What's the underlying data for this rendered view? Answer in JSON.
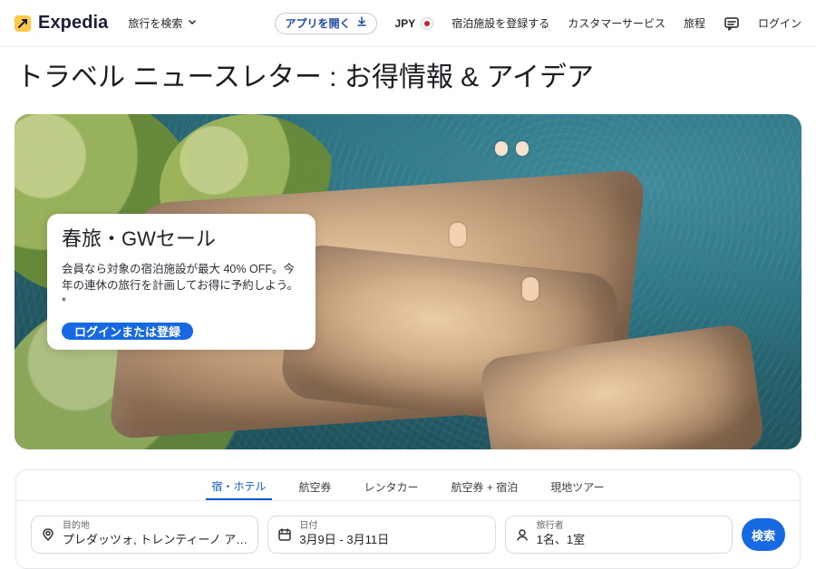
{
  "header": {
    "logo_text": "Expedia",
    "shop_label": "旅行を検索",
    "app_pill_label": "アプリを開く",
    "currency_label": "JPY",
    "register_label": "宿泊施設を登録する",
    "support_label": "カスタマーサービス",
    "trips_label": "旅程",
    "login_label": "ログイン"
  },
  "page": {
    "title": "トラベル ニュースレター : お得情報 & アイデア"
  },
  "promo": {
    "title": "春旅・GWセール",
    "text": "会員なら対象の宿泊施設が最大 40% OFF。今年の連休の旅行を計画してお得に予約しよう。*",
    "cta_label": "ログインまたは登録"
  },
  "search": {
    "tabs": [
      {
        "label": "宿・ホテル",
        "active": true
      },
      {
        "label": "航空券",
        "active": false
      },
      {
        "label": "レンタカー",
        "active": false
      },
      {
        "label": "航空券 + 宿泊",
        "active": false
      },
      {
        "label": "現地ツアー",
        "active": false
      }
    ],
    "fields": {
      "destination": {
        "label": "目的地",
        "value": "プレダッツォ, トレンティーノ アルト ..."
      },
      "dates": {
        "label": "日付",
        "value": "3月9日 - 3月11日"
      },
      "travelers": {
        "label": "旅行者",
        "value": "1名、1室"
      }
    },
    "button_label": "検索"
  },
  "colors": {
    "brand_blue": "#1668e3",
    "expedia_yellow": "#ffc94a"
  },
  "icons": {
    "logo": "expedia-logo-icon",
    "download": "download-icon",
    "chevron_down": "chevron-down-icon",
    "message": "message-icon",
    "location": "location-pin-icon",
    "calendar": "calendar-icon",
    "user": "user-icon"
  }
}
